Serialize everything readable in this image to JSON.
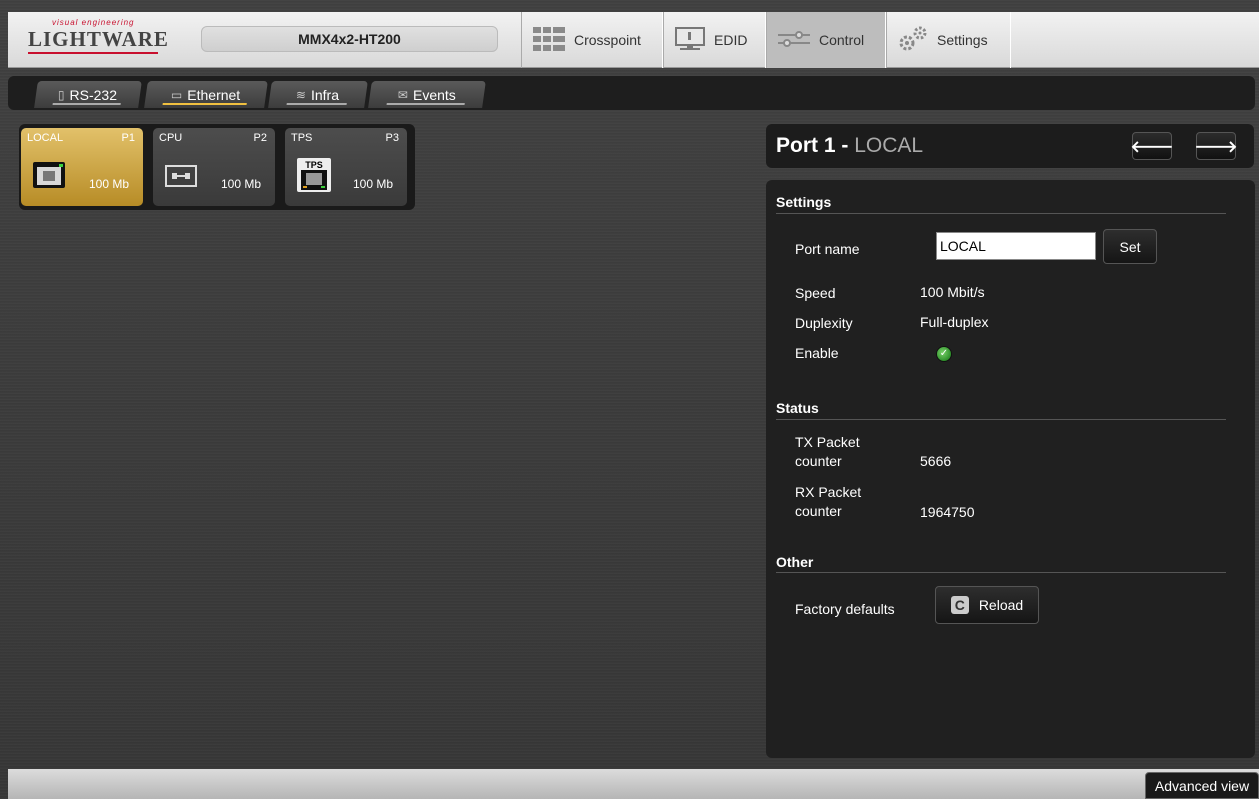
{
  "brand": {
    "tagline": "visual engineering",
    "name": "LIGHTWARE",
    "accent": "#c8102e"
  },
  "device": {
    "name": "MMX4x2-HT200"
  },
  "nav": {
    "tabs": [
      {
        "label": "Crosspoint",
        "icon": "crosspoint-grid-icon"
      },
      {
        "label": "EDID",
        "icon": "monitor-icon"
      },
      {
        "label": "Control",
        "icon": "sliders-icon",
        "active": true
      },
      {
        "label": "Settings",
        "icon": "gears-icon"
      }
    ]
  },
  "subtabs": [
    {
      "label": "RS-232",
      "icon": "serial-icon"
    },
    {
      "label": "Ethernet",
      "icon": "ethernet-icon",
      "active": true
    },
    {
      "label": "Infra",
      "icon": "infrared-icon"
    },
    {
      "label": "Events",
      "icon": "events-icon"
    }
  ],
  "ports": [
    {
      "name": "LOCAL",
      "num": "P1",
      "speed": "100 Mb",
      "icon": "rj45-icon",
      "active": true
    },
    {
      "name": "CPU",
      "num": "P2",
      "speed": "100 Mb",
      "icon": "cpu-link-icon"
    },
    {
      "name": "TPS",
      "num": "P3",
      "speed": "100 Mb",
      "icon": "tps-icon"
    }
  ],
  "detail": {
    "title": "Port 1",
    "separator": " - ",
    "subtitle": "LOCAL",
    "prev_label": "🡐",
    "next_label": "🡒",
    "settings": {
      "heading": "Settings",
      "port_name_label": "Port name",
      "port_name_value": "LOCAL",
      "set_label": "Set",
      "speed_label": "Speed",
      "speed_value": "100 Mbit/s",
      "duplexity_label": "Duplexity",
      "duplexity_value": "Full-duplex",
      "enable_label": "Enable",
      "enable_state": "on"
    },
    "status": {
      "heading": "Status",
      "tx_label_1": "TX Packet",
      "tx_label_2": "counter",
      "tx_value": "5666",
      "rx_label_1": "RX Packet",
      "rx_label_2": "counter",
      "rx_value": "1964750"
    },
    "other": {
      "heading": "Other",
      "factory_label": "Factory defaults",
      "reload_label": "Reload"
    }
  },
  "footer": {
    "advanced_label": "Advanced view"
  },
  "colors": {
    "active_port": "#d4ac47",
    "active_subtab_underline": "#f0c040",
    "enable_green": "#3fa535"
  }
}
